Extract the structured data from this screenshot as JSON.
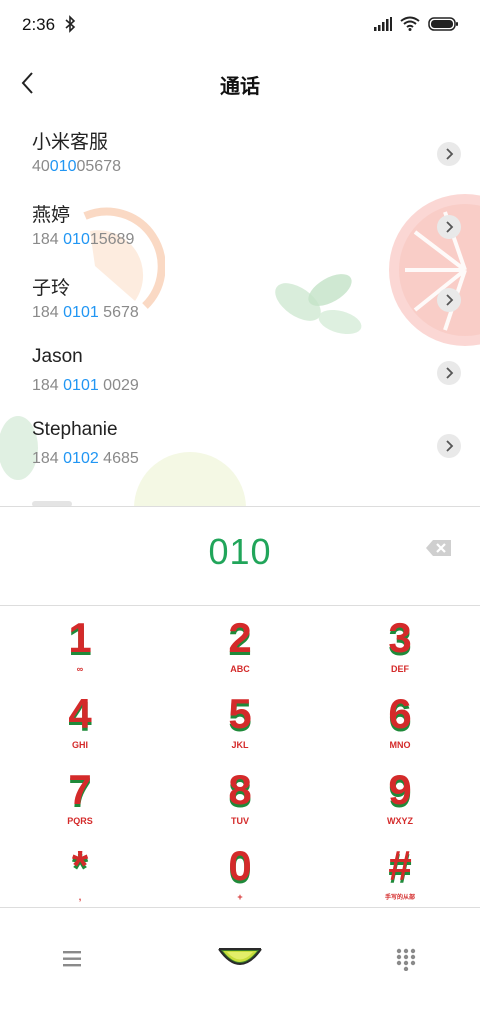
{
  "status": {
    "time": "2:36"
  },
  "header": {
    "title": "通话"
  },
  "contacts": [
    {
      "name": "小米客服",
      "pre": "40",
      "match": "010",
      "post": "05678"
    },
    {
      "name": "燕婷",
      "pre": "184 ",
      "match": "010",
      "post": "15689"
    },
    {
      "name": "子玲",
      "pre": "184 ",
      "match": "0101",
      "post": " 5678"
    },
    {
      "name": "Jason",
      "pre": "184 ",
      "match": "0101",
      "post": " 0029"
    },
    {
      "name": "Stephanie",
      "pre": "184 ",
      "match": "0102",
      "post": " 4685"
    }
  ],
  "dialer": {
    "digits": "010"
  },
  "keys": [
    {
      "digit": "1",
      "letters": "∞"
    },
    {
      "digit": "2",
      "letters": "ABC"
    },
    {
      "digit": "3",
      "letters": "DEF"
    },
    {
      "digit": "4",
      "letters": "GHI"
    },
    {
      "digit": "5",
      "letters": "JKL"
    },
    {
      "digit": "6",
      "letters": "MNO"
    },
    {
      "digit": "7",
      "letters": "PQRS"
    },
    {
      "digit": "8",
      "letters": "TUV"
    },
    {
      "digit": "9",
      "letters": "WXYZ"
    },
    {
      "digit": "*",
      "letters": ","
    },
    {
      "digit": "0",
      "letters": "+"
    },
    {
      "digit": "#",
      "letters": "手写的从部"
    }
  ],
  "colors": {
    "match": "#2196f3",
    "digits": "#21a55a",
    "key_red": "#d42a2a",
    "key_green": "#1f8a3a"
  },
  "icons": {
    "bottom_left": "menu-icon",
    "bottom_center": "melon-call-icon",
    "bottom_right": "dialpad-icon"
  }
}
